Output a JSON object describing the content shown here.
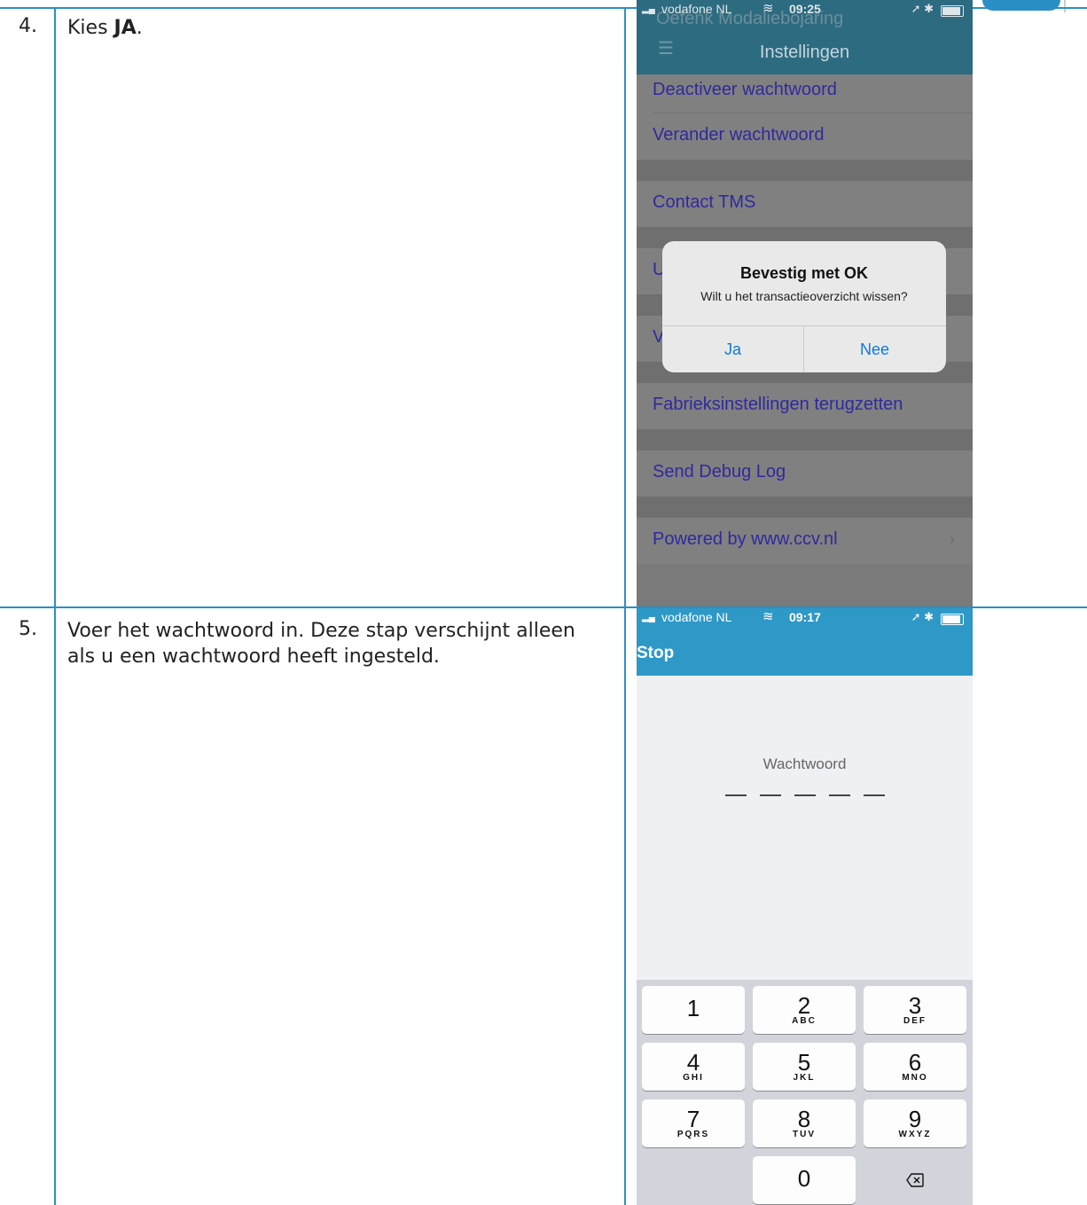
{
  "steps": [
    {
      "number": "4.",
      "text_prefix": "Kies ",
      "text_bold": "JA",
      "text_suffix": "."
    },
    {
      "number": "5.",
      "text": "Voer het wachtwoord in. Deze stap verschijnt alleen als u een wachtwoord heeft ingesteld."
    }
  ],
  "screen1": {
    "status": {
      "carrier": "vodafone NL",
      "time": "09:25"
    },
    "ghost_title": "Oefenk Modaliebojaring",
    "title": "Instellingen",
    "menu_icon": "hamburger-icon",
    "rows": [
      "Deactiveer wachtwoord",
      "Verander wachtwoord",
      "Contact TMS",
      "U",
      "V",
      "Fabrieksinstellingen terugzetten",
      "Send Debug Log",
      "Powered by www.ccv.nl"
    ],
    "dialog": {
      "title": "Bevestig met OK",
      "message": "Wilt u het transactieoverzicht wissen?",
      "yes": "Ja",
      "no": "Nee"
    }
  },
  "screen2": {
    "status": {
      "carrier": "vodafone NL",
      "time": "09:17"
    },
    "stop": "Stop",
    "password_label": "Wachtwoord",
    "keys": [
      {
        "num": "1",
        "letters": ""
      },
      {
        "num": "2",
        "letters": "ABC"
      },
      {
        "num": "3",
        "letters": "DEF"
      },
      {
        "num": "4",
        "letters": "GHI"
      },
      {
        "num": "5",
        "letters": "JKL"
      },
      {
        "num": "6",
        "letters": "MNO"
      },
      {
        "num": "7",
        "letters": "PQRS"
      },
      {
        "num": "8",
        "letters": "TUV"
      },
      {
        "num": "9",
        "letters": "WXYZ"
      },
      {
        "num": "0",
        "letters": ""
      }
    ],
    "delete_icon": "backspace-icon"
  }
}
